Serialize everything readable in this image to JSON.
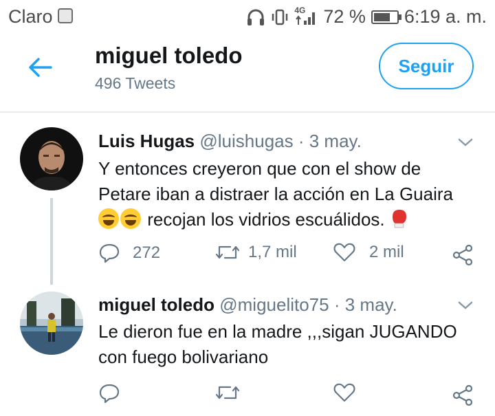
{
  "status_bar": {
    "carrier": "Claro",
    "battery_percent": "72 %",
    "battery_level": 0.72,
    "network_label": "4G",
    "time": "6:19 a. m."
  },
  "header": {
    "name": "miguel toledo",
    "tweet_count": "496 Tweets",
    "follow_label": "Seguir"
  },
  "tweets": [
    {
      "name": "Luis Hugas",
      "handle": "@luishugas",
      "date": "· 3 may.",
      "text_line1": "Y entonces creyeron que con el show de",
      "text_line2": "Petare iban a distraer la acción en La Guaira",
      "text_line3": "recojan los vidrios escuálidos.",
      "replies": "272",
      "retweets": "1,7 mil",
      "likes": "2 mil"
    },
    {
      "name": "miguel toledo",
      "handle": "@miguelito75",
      "date": "· 3 may.",
      "text_line1": "Le dieron fue en la madre ,,,sigan JUGANDO",
      "text_line2": "con fuego bolivariano"
    }
  ],
  "colors": {
    "accent": "#1da1f2",
    "secondary_text": "#657786",
    "divider": "#e6ecf0"
  }
}
